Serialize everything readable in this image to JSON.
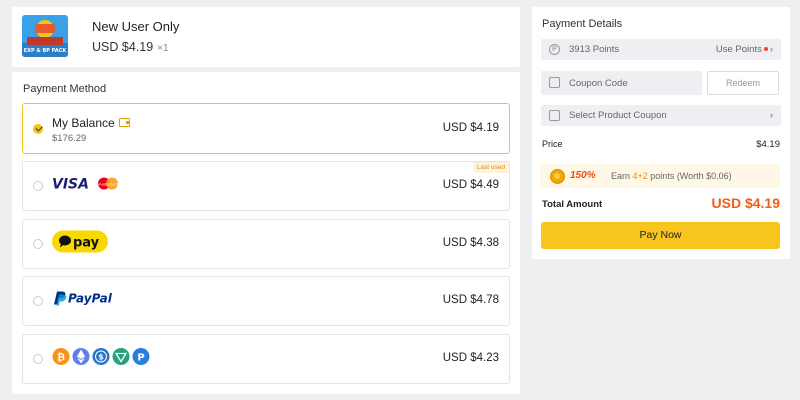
{
  "product": {
    "name": "New User Only",
    "price": "USD $4.19",
    "quantity": "×1",
    "thumbnail_text": "EXP & BP PACK"
  },
  "payment_method": {
    "title": "Payment Method",
    "options": [
      {
        "id": "balance",
        "label": "My Balance",
        "sub": "$176.29",
        "price": "USD $4.19",
        "selected": true,
        "icon": "wallet-icon"
      },
      {
        "id": "visa-mastercard",
        "logo": "VISA",
        "logo2": "mastercard",
        "price": "USD $4.49",
        "badge": "Last used",
        "selected": false
      },
      {
        "id": "gopay",
        "logo": "pay",
        "price": "USD $4.38",
        "selected": false
      },
      {
        "id": "paypal",
        "logo": "PayPal",
        "price": "USD $4.78",
        "selected": false
      },
      {
        "id": "crypto",
        "logo": "crypto-coins",
        "price": "USD $4.23",
        "selected": false
      }
    ]
  },
  "payment_details": {
    "title": "Payment Details",
    "points": {
      "value": "3913 Points",
      "action": "Use Points"
    },
    "coupon": {
      "placeholder": "Coupon Code",
      "redeem_label": "Redeem"
    },
    "product_coupon": {
      "label": "Select Product Coupon"
    },
    "price": {
      "label": "Price",
      "value": "$4.19"
    },
    "earn": {
      "percent": "150%",
      "prefix": "Earn ",
      "points": "4+2",
      "suffix": " points (Worth $0.06)"
    },
    "total": {
      "label": "Total Amount",
      "value": "USD $4.19"
    },
    "pay_button": "Pay Now"
  },
  "colors": {
    "accent": "#f7c51c",
    "total": "#f25c19",
    "background": "#eeeff1",
    "visa_blue": "#1a1f71",
    "paypal_blue": "#003087",
    "paypal_light": "#0096d8"
  }
}
